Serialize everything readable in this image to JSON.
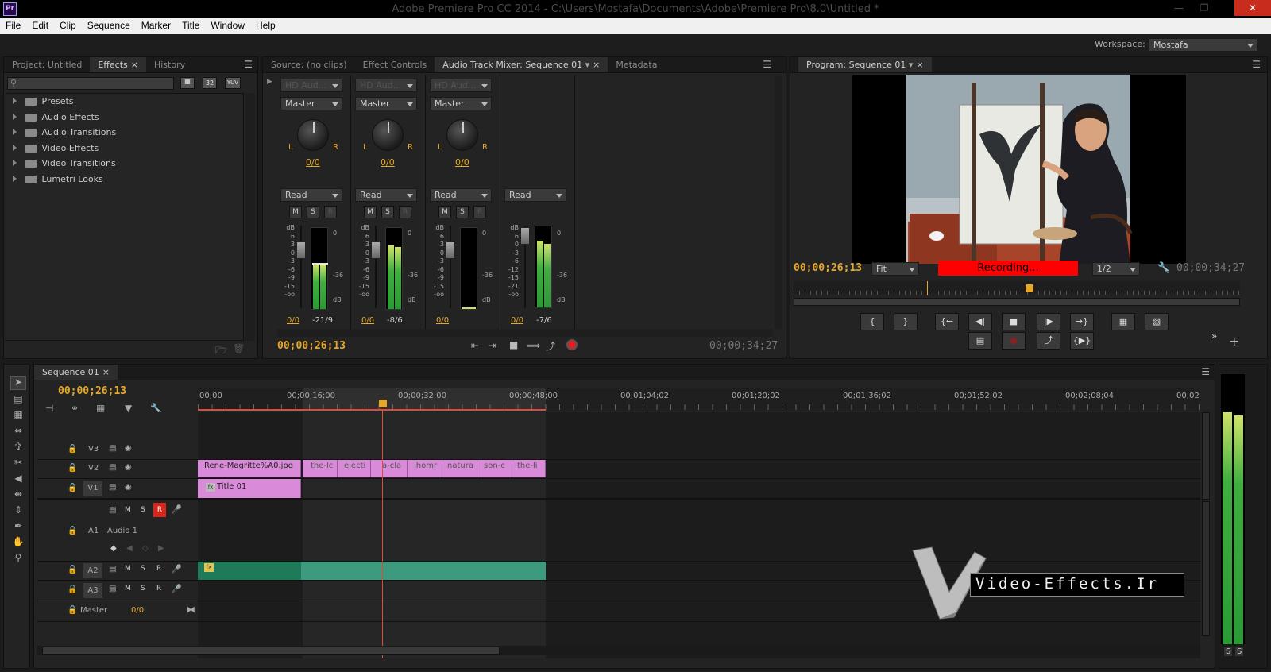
{
  "app": {
    "title": "Adobe Premiere Pro CC 2014 - C:\\Users\\Mostafa\\Documents\\Adobe\\Premiere Pro\\8.0\\Untitled *",
    "logo": "Pr"
  },
  "menu": [
    "File",
    "Edit",
    "Clip",
    "Sequence",
    "Marker",
    "Title",
    "Window",
    "Help"
  ],
  "workspace": {
    "label": "Workspace:",
    "value": "Mostafa"
  },
  "left_panel": {
    "tabs": [
      "Project: Untitled",
      "Effects",
      "History"
    ],
    "active_tab": "Effects",
    "search_placeholder": "",
    "filter_labels": [
      "32",
      "YUV"
    ],
    "tree": [
      "Presets",
      "Audio Effects",
      "Audio Transitions",
      "Video Effects",
      "Video Transitions",
      "Lumetri Looks"
    ]
  },
  "mixer": {
    "tabs": [
      "Source: (no clips)",
      "Effect Controls",
      "Audio Track Mixer: Sequence 01",
      "Metadata"
    ],
    "active_tab": "Audio Track Mixer: Sequence 01",
    "channels": [
      {
        "input": "HD Aud...",
        "output": "Master",
        "pan": "0/0",
        "mode": "Read",
        "vol": "0/0",
        "peak": "-21/9",
        "L": "L",
        "R": "R"
      },
      {
        "input": "HD Aud...",
        "output": "Master",
        "pan": "0/0",
        "mode": "Read",
        "vol": "0/0",
        "peak": "-8/6",
        "L": "L",
        "R": "R"
      },
      {
        "input": "HD Aud...",
        "output": "Master",
        "pan": "0/0",
        "mode": "Read",
        "vol": "0/0",
        "peak": "",
        "L": "L",
        "R": "R"
      }
    ],
    "master": {
      "mode": "Read",
      "vol": "0/0",
      "peak": "-7/6"
    },
    "msr": [
      "M",
      "S",
      "R"
    ],
    "db_scale": [
      "dB",
      "6",
      "3",
      "0",
      "-3",
      "-6",
      "-9",
      "-15",
      "-oo"
    ],
    "meter_scale": [
      "0",
      "-36",
      "dB"
    ],
    "master_scale": [
      "dB",
      "6",
      "0",
      "-3",
      "-6",
      "-12",
      "-15",
      "-21",
      "-oo"
    ],
    "current_time": "00;00;26;13",
    "duration": "00;00;34;27"
  },
  "program": {
    "tab": "Program: Sequence 01",
    "current_time": "00;00;26;13",
    "fit": "Fit",
    "recording": "Recording...",
    "resolution": "1/2",
    "duration": "00;00;34;27"
  },
  "timeline": {
    "tab": "Sequence 01",
    "current_time": "00;00;26;13",
    "ruler": [
      "00;00",
      "00;00;16;00",
      "00;00;32;00",
      "00;00;48;00",
      "00;01;04;02",
      "00;01;20;02",
      "00;01;36;02",
      "00;01;52;02",
      "00;02;08;04",
      "00;02"
    ],
    "video_tracks": [
      {
        "name": "V3"
      },
      {
        "name": "V2"
      },
      {
        "name": "V1"
      }
    ],
    "audio_tracks": [
      {
        "name": "A1",
        "label": "Audio 1"
      },
      {
        "name": "A2"
      },
      {
        "name": "A3"
      }
    ],
    "master": {
      "name": "Master",
      "value": "0/0"
    },
    "track_buttons": [
      "M",
      "S",
      "R"
    ],
    "v2_clips": [
      "Rene-Magritte%A0.jpg",
      "the-lc",
      "electi",
      "a-cla",
      "lhomr",
      "natura",
      "son-c",
      "the-li"
    ],
    "v1_clip": "Title 01",
    "fx_label": "fx"
  },
  "watermark": "Video-Effects.Ir",
  "meter_right": [
    "S",
    "S"
  ],
  "colors": {
    "accent_time": "#e6a82a",
    "recording": "#ff0000",
    "clip_video": "#d98ad9",
    "clip_audio": "#3a9a7a",
    "playhead": "#e04a3a"
  }
}
